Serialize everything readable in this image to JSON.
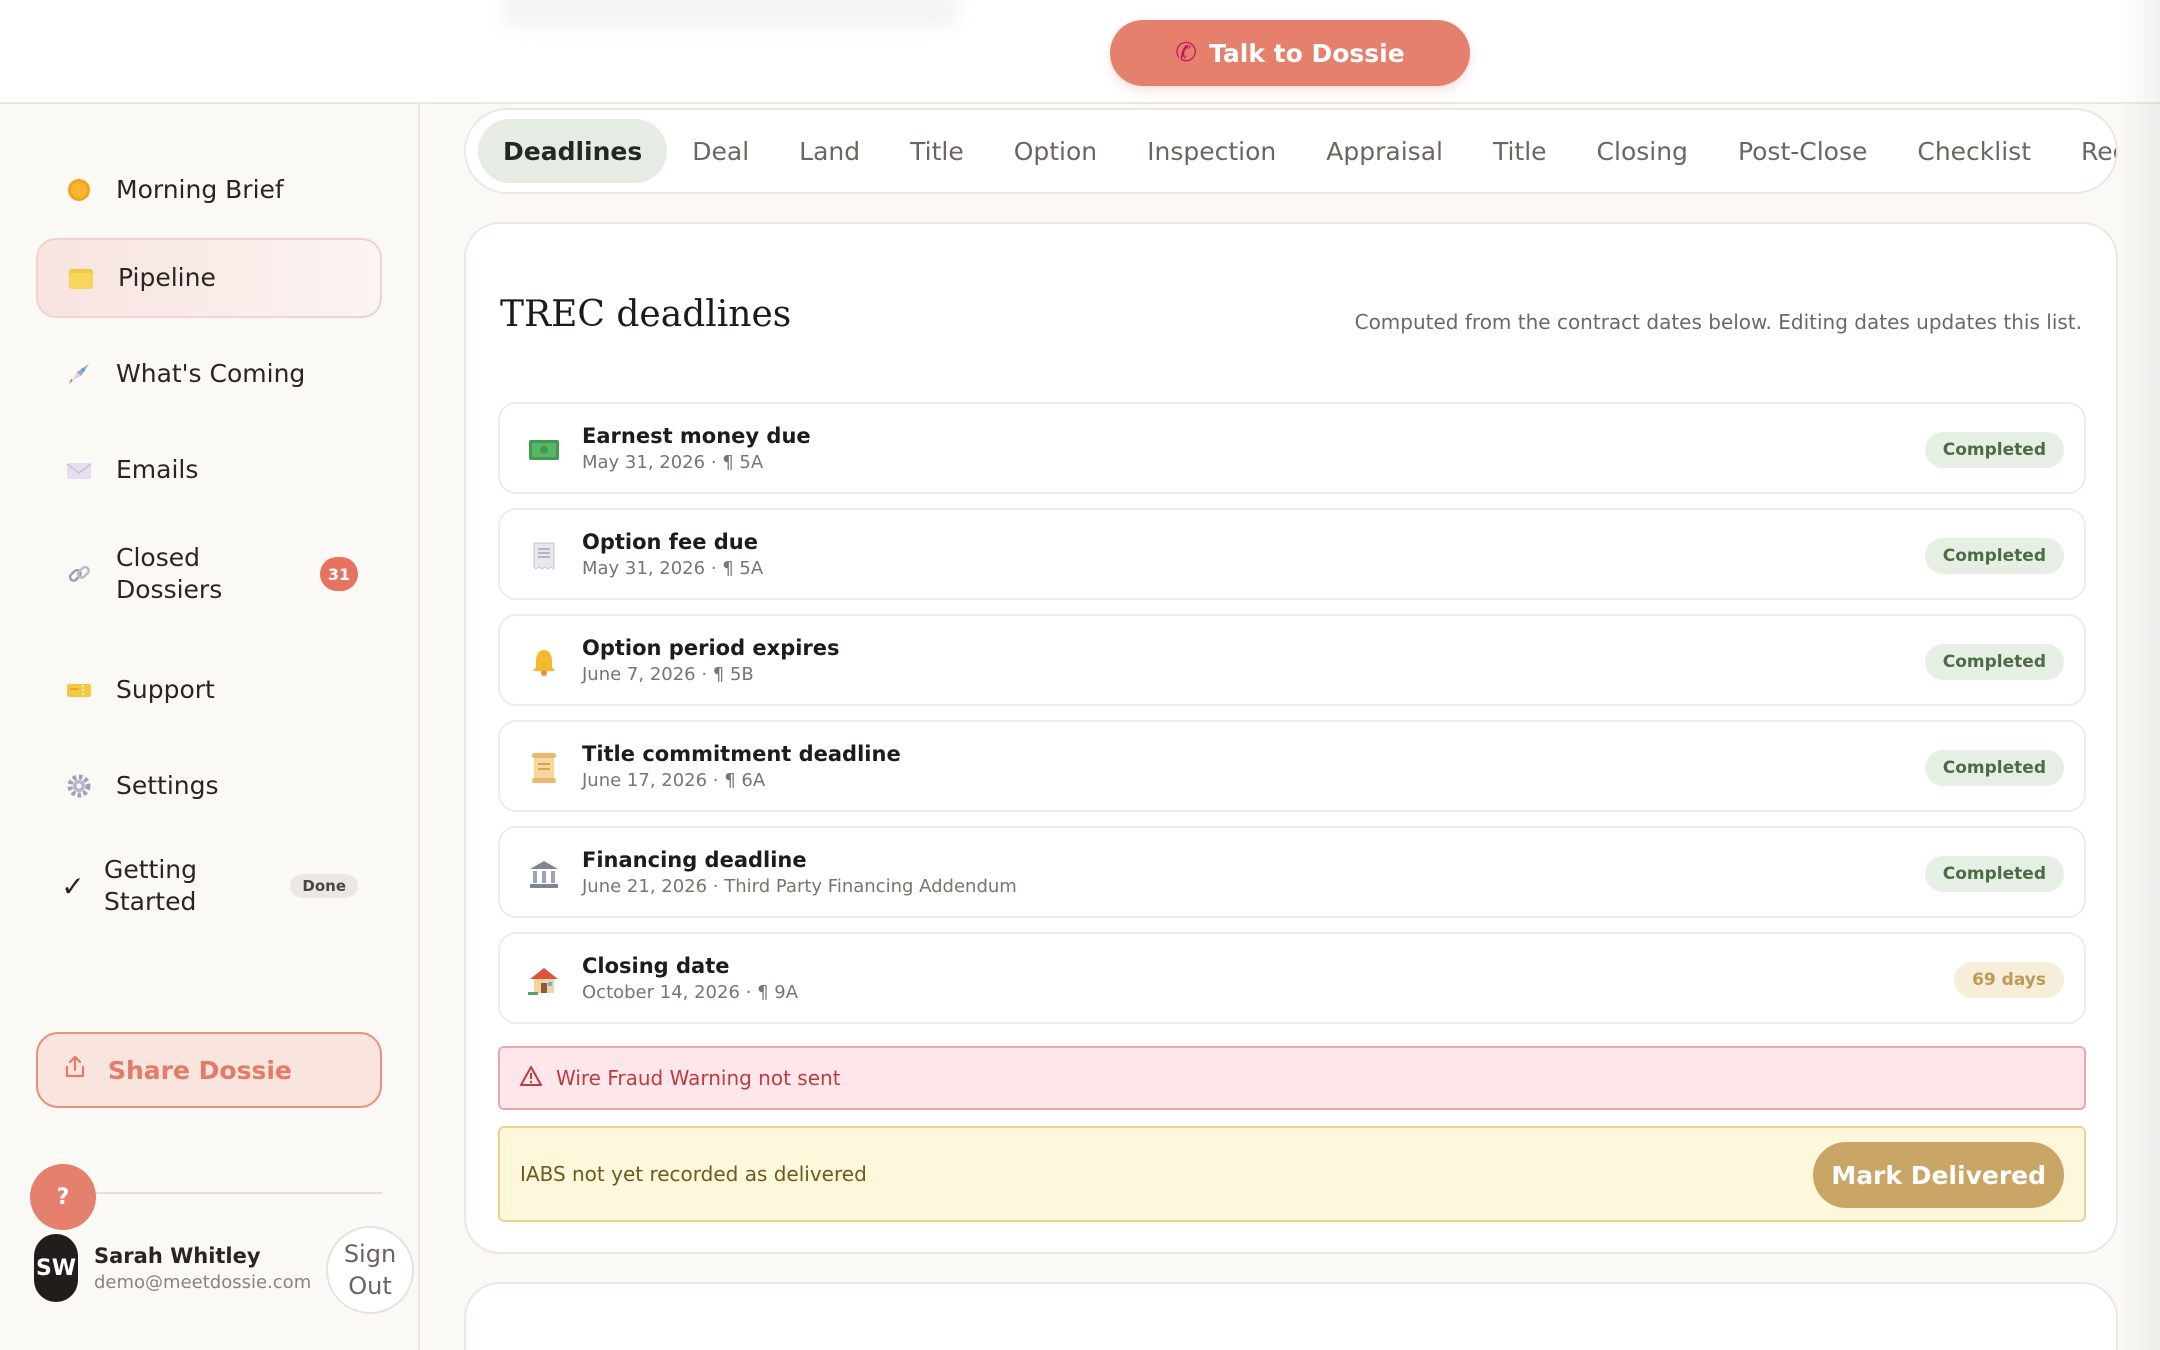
{
  "topbar": {
    "talk_label": "Talk to Dossie",
    "talk_icon": "phone-icon"
  },
  "sidebar": {
    "items": [
      {
        "label": "Morning Brief",
        "icon": "sun-icon"
      },
      {
        "label": "Pipeline",
        "icon": "folder-icon",
        "active": true
      },
      {
        "label": "What's Coming",
        "icon": "rocket-icon"
      },
      {
        "label": "Emails",
        "icon": "envelope-icon"
      },
      {
        "label": "Closed Dossiers",
        "icon": "link-icon",
        "badge": "31"
      },
      {
        "label": "Support",
        "icon": "ticket-icon"
      },
      {
        "label": "Settings",
        "icon": "gear-icon"
      },
      {
        "label": "Getting Started",
        "icon": "checkmark-icon",
        "badge": "Done"
      }
    ],
    "share_label": "Share Dossie",
    "help_label": "?",
    "user": {
      "initials": "SW",
      "name": "Sarah Whitley",
      "email": "demo@meetdossie.com"
    },
    "signout_label": "Sign Out"
  },
  "tabs": [
    "Deadlines",
    "Deal",
    "Land",
    "Title",
    "Option",
    "Inspection",
    "Appraisal",
    "Title",
    "Closing",
    "Post-Close",
    "Checklist",
    "Require"
  ],
  "active_tab": "Deadlines",
  "deadlines": {
    "title": "TREC deadlines",
    "subtitle": "Computed from the contract dates below. Editing dates updates this list.",
    "rows": [
      {
        "icon": "money-icon",
        "title": "Earnest money due",
        "meta": "May 31, 2026 · ¶ 5A",
        "status": "Completed"
      },
      {
        "icon": "receipt-icon",
        "title": "Option fee due",
        "meta": "May 31, 2026 · ¶ 5A",
        "status": "Completed"
      },
      {
        "icon": "bell-icon",
        "title": "Option period expires",
        "meta": "June 7, 2026 · ¶ 5B",
        "status": "Completed"
      },
      {
        "icon": "scroll-icon",
        "title": "Title commitment deadline",
        "meta": "June 17, 2026 · ¶ 6A",
        "status": "Completed"
      },
      {
        "icon": "bank-icon",
        "title": "Financing deadline",
        "meta": "June 21, 2026 · Third Party Financing Addendum",
        "status": "Completed"
      },
      {
        "icon": "house-icon",
        "title": "Closing date",
        "meta": "October 14, 2026 · ¶ 9A",
        "status": "69 days"
      }
    ],
    "wire_warning": "Wire Fraud Warning not sent",
    "iabs_notice": "IABS not yet recorded as delivered",
    "mark_delivered_label": "Mark Delivered"
  },
  "colors": {
    "accent": "#e5806c",
    "completed_bg": "#e6efe3",
    "warning_red": "#c13a40",
    "gold": "#c9a566"
  }
}
